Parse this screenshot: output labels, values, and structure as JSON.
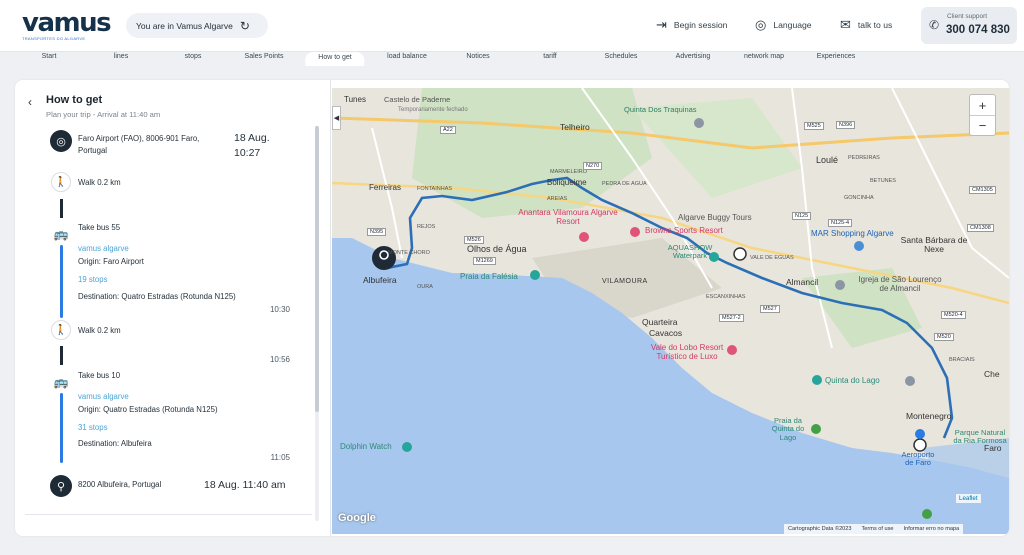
{
  "header": {
    "logo_text": "vamus",
    "logo_subtitle": "TRANSPORTES DO ALGARVE",
    "location_text": "You are in Vamus Algarve",
    "begin_session": "Begin session",
    "language": "Language",
    "talk_to_us": "talk to us",
    "client_support_label": "Client support",
    "client_support_number": "300 074 830"
  },
  "nav": [
    "Start",
    "lines",
    "stops",
    "Sales Points",
    "How to get",
    "load balance",
    "Notices",
    "tariff",
    "Schedules",
    "Advertising",
    "network map",
    "Experiences"
  ],
  "panel": {
    "title": "How to get",
    "subtitle": "Plan your trip - Arrival at 11:40 am",
    "origin": {
      "address": "Faro Airport (FAO), 8006-901 Faro, Portugal",
      "date": "18 Aug.",
      "time": "10:27"
    },
    "walk1": "Walk 0.2 km",
    "bus1": {
      "title": "Take bus 55",
      "operator": "vamus algarve",
      "origin": "Origin: Faro Airport",
      "stops": "19 stops",
      "destination": "Destination: Quatro Estradas (Rotunda N125)",
      "time": "10:30"
    },
    "walk2": "Walk 0.2 km",
    "walk2_time": "10:56",
    "bus2": {
      "title": "Take bus 10",
      "operator": "vamus algarve",
      "origin": "Origin: Quatro Estradas (Rotunda N125)",
      "stops": "31 stops",
      "destination": "Destination: Albufeira",
      "time": "11:05"
    },
    "destination": {
      "address": "8200 Albufeira, Portugal",
      "datetime": "18 Aug. 11:40 am"
    }
  },
  "map": {
    "zoom_in": "+",
    "zoom_out": "−",
    "collapse": "◀",
    "google": "Google",
    "leaflet": "Leaflet",
    "attribution": [
      "Cartographic Data ©2023",
      "Terms of use",
      "Informar erro no mapa"
    ],
    "places": [
      "Tunes",
      "Castelo de Paderne",
      "Temporariamente fechado",
      "Quinta Dos Traquinas",
      "Telheiro",
      "Loulé",
      "Ferreiras",
      "FONTAINHAS",
      "Boliqueime",
      "PEDRA DE AGUA",
      "PEDREIRAS",
      "BETUNES",
      "GONCINHA",
      "Anantara Vilamoura Algarve Resort",
      "Browns Sports Resort",
      "Algarve Buggy Tours",
      "MAR Shopping Algarve",
      "Santa Bárbara de Nexe",
      "Olhos de Água",
      "Albufeira",
      "Praia da Falésia",
      "AQUASHOW Waterpark",
      "VILAMOURA",
      "Almancil",
      "Igreja de São Lourenço de Almancil",
      "Quarteira",
      "Cavacos",
      "Vale do Lobo Resort Turístico de Luxo",
      "Quinta do Lago",
      "Montenegro",
      "Praia da Quinta do Lago",
      "Dolphin Watch",
      "Aeroporto de Faro",
      "Parque Natural da Ria Formosa",
      "Faro",
      "Che",
      "ESCANXINHAS",
      "VALE DE EGUAS",
      "BRACIAIS",
      "MONTE CHORO",
      "REJOS",
      "OURA",
      "AREIAS",
      "MARMELEIRO"
    ],
    "roads": [
      "A22",
      "N270",
      "M525",
      "N396",
      "CM1305",
      "N125",
      "N395",
      "M526",
      "M1269",
      "N125-4",
      "CM1308",
      "M527",
      "M527-2",
      "M520-4",
      "M520"
    ]
  },
  "colors": {
    "route": "#2c6fb6",
    "bus": "#2c7be5",
    "water": "#a7c7ee",
    "land": "#e8e5dc"
  }
}
